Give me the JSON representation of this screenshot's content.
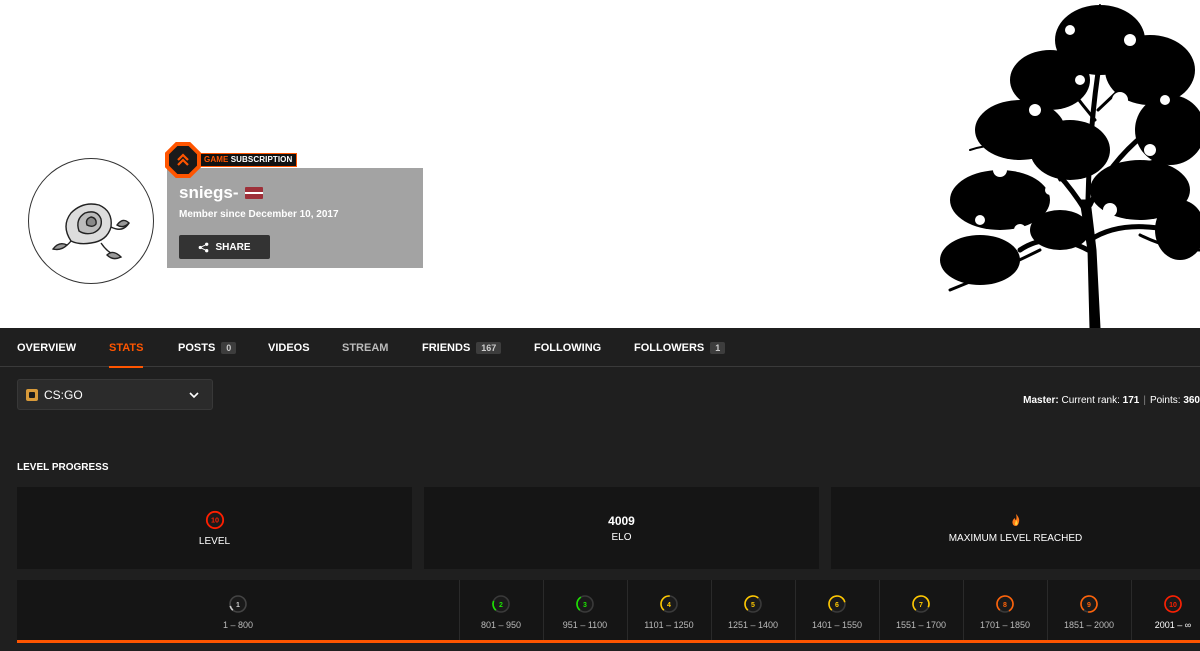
{
  "profile": {
    "badge_game": "GAME",
    "badge_sub": "SUBSCRIPTION",
    "username": "sniegs-",
    "member_since": "Member since December 10, 2017",
    "share_label": "SHARE",
    "flag": "latvia-flag"
  },
  "nav": {
    "tabs": [
      {
        "label": "OVERVIEW"
      },
      {
        "label": "STATS"
      },
      {
        "label": "POSTS",
        "count": "0"
      },
      {
        "label": "VIDEOS"
      },
      {
        "label": "STREAM"
      },
      {
        "label": "FRIENDS",
        "count": "167"
      },
      {
        "label": "FOLLOWING"
      },
      {
        "label": "FOLLOWERS",
        "count": "1"
      }
    ],
    "active": "STATS"
  },
  "game_select": {
    "value": "CS:GO"
  },
  "rank": {
    "master_label": "Master:",
    "current_rank_label": "Current rank:",
    "current_rank": "171",
    "separator": "|",
    "points_label": "Points:",
    "points": "360"
  },
  "level_progress": {
    "title": "LEVEL PROGRESS",
    "level_value": "10",
    "level_caption": "LEVEL",
    "elo_value": "4009",
    "elo_caption": "ELO",
    "max_caption": "MAXIMUM LEVEL REACHED",
    "levels": [
      {
        "level": "1",
        "range": "1 – 800",
        "color": "#cccccc"
      },
      {
        "level": "2",
        "range": "801 – 950",
        "color": "#1ce400"
      },
      {
        "level": "3",
        "range": "951 – 1100",
        "color": "#1ce400"
      },
      {
        "level": "4",
        "range": "1101 – 1250",
        "color": "#ffc800"
      },
      {
        "level": "5",
        "range": "1251 – 1400",
        "color": "#ffc800"
      },
      {
        "level": "6",
        "range": "1401 – 1550",
        "color": "#ffc800"
      },
      {
        "level": "7",
        "range": "1551 – 1700",
        "color": "#ffc800"
      },
      {
        "level": "8",
        "range": "1701 – 1850",
        "color": "#ff6309"
      },
      {
        "level": "9",
        "range": "1851 – 2000",
        "color": "#ff6309"
      },
      {
        "level": "10",
        "range": "2001 – ∞",
        "color": "#fe1f00"
      }
    ]
  },
  "colors": {
    "accent": "#ff5500",
    "dark_bg": "#1f1f1f",
    "card_bg": "#151515"
  }
}
